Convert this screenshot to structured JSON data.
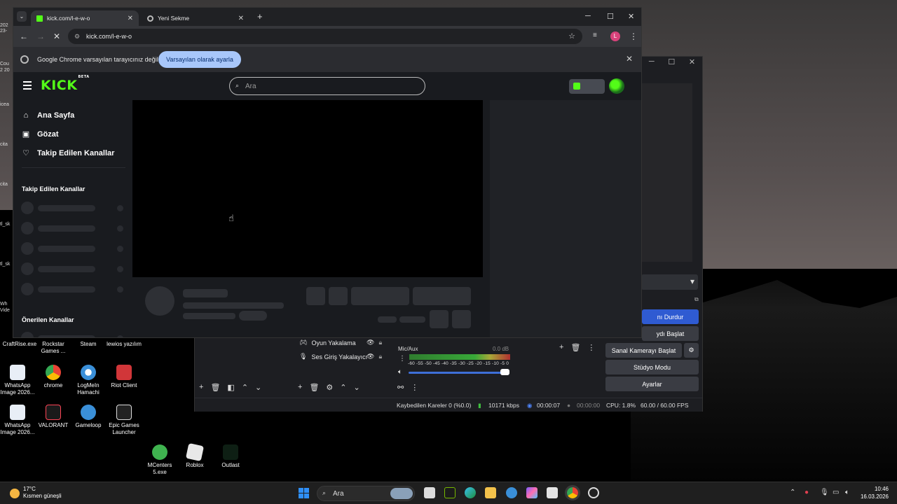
{
  "browser": {
    "tabs": [
      {
        "label": "kick.com/l-e-w-o",
        "active": true
      },
      {
        "label": "Yeni Sekme",
        "active": false
      }
    ],
    "new_tab": "+",
    "url": "kick.com/l-e-w-o",
    "infobar": {
      "message": "Google Chrome varsayılan tarayıcınız değil",
      "button": "Varsayılan olarak ayarla"
    },
    "profile_initial": "L"
  },
  "kick": {
    "logo": "KICK",
    "logo_badge": "BETA",
    "search_placeholder": "Ara",
    "nav": [
      {
        "label": "Ana Sayfa",
        "icon": "home-icon"
      },
      {
        "label": "Gözat",
        "icon": "browse-icon"
      },
      {
        "label": "Takip Edilen Kanallar",
        "icon": "heart-icon"
      }
    ],
    "followed_heading": "Takip Edilen Kanallar",
    "recommended_heading": "Önerilen Kanallar",
    "accent": "#53fc18"
  },
  "obs": {
    "sources": [
      {
        "label": "Oyun Yakalama"
      },
      {
        "label": "Ses Giriş Yakalayıcı"
      }
    ],
    "mixer": {
      "channel": "Mic/Aux",
      "level": "0.0 dB",
      "scale": "-60 -55 -50 -45 -40 -35 -30 -25 -20 -15 -10 -5 0"
    },
    "controls": {
      "stop_stream": "nı Durdur",
      "start_record": "ydı Başlat",
      "virtual_camera": "Sanal Kamerayı Başlat",
      "studio_mode": "Stüdyo Modu",
      "settings": "Ayarlar"
    },
    "status": {
      "dropped": "Kaybedilen Kareler 0 (%0.0)",
      "bitrate": "10171 kbps",
      "stream_time": "00:00:07",
      "record_time": "00:00:00",
      "cpu": "CPU: 1.8%",
      "fps": "60.00 / 60.00 FPS"
    }
  },
  "desktop": {
    "icons": [
      {
        "label": "CraftRise.exe"
      },
      {
        "label": "Rockstar Games ..."
      },
      {
        "label": "Steam"
      },
      {
        "label": "lewios yazılım"
      },
      {
        "label": "WhatsApp Image 2026..."
      },
      {
        "label": "chrome"
      },
      {
        "label": "LogMeIn Hamachi"
      },
      {
        "label": "Riot Client"
      },
      {
        "label": "WhatsApp Image 2026..."
      },
      {
        "label": "VALORANT"
      },
      {
        "label": "Gameloop"
      },
      {
        "label": "Epic Games Launcher"
      },
      {
        "label": "MCenters 5.exe"
      },
      {
        "label": "Roblox"
      },
      {
        "label": "Outlast"
      }
    ],
    "left_edge": [
      "202",
      "23-",
      "Cou",
      "2 20",
      "icea",
      "cita",
      "cita",
      "tl_sk",
      "tl_sk",
      "Wh",
      "Vide"
    ]
  },
  "taskbar": {
    "weather_temp": "17°C",
    "weather_text": "Kısmen güneşli",
    "search": "Ara",
    "time": "10:46",
    "date": "16.03.2026"
  }
}
